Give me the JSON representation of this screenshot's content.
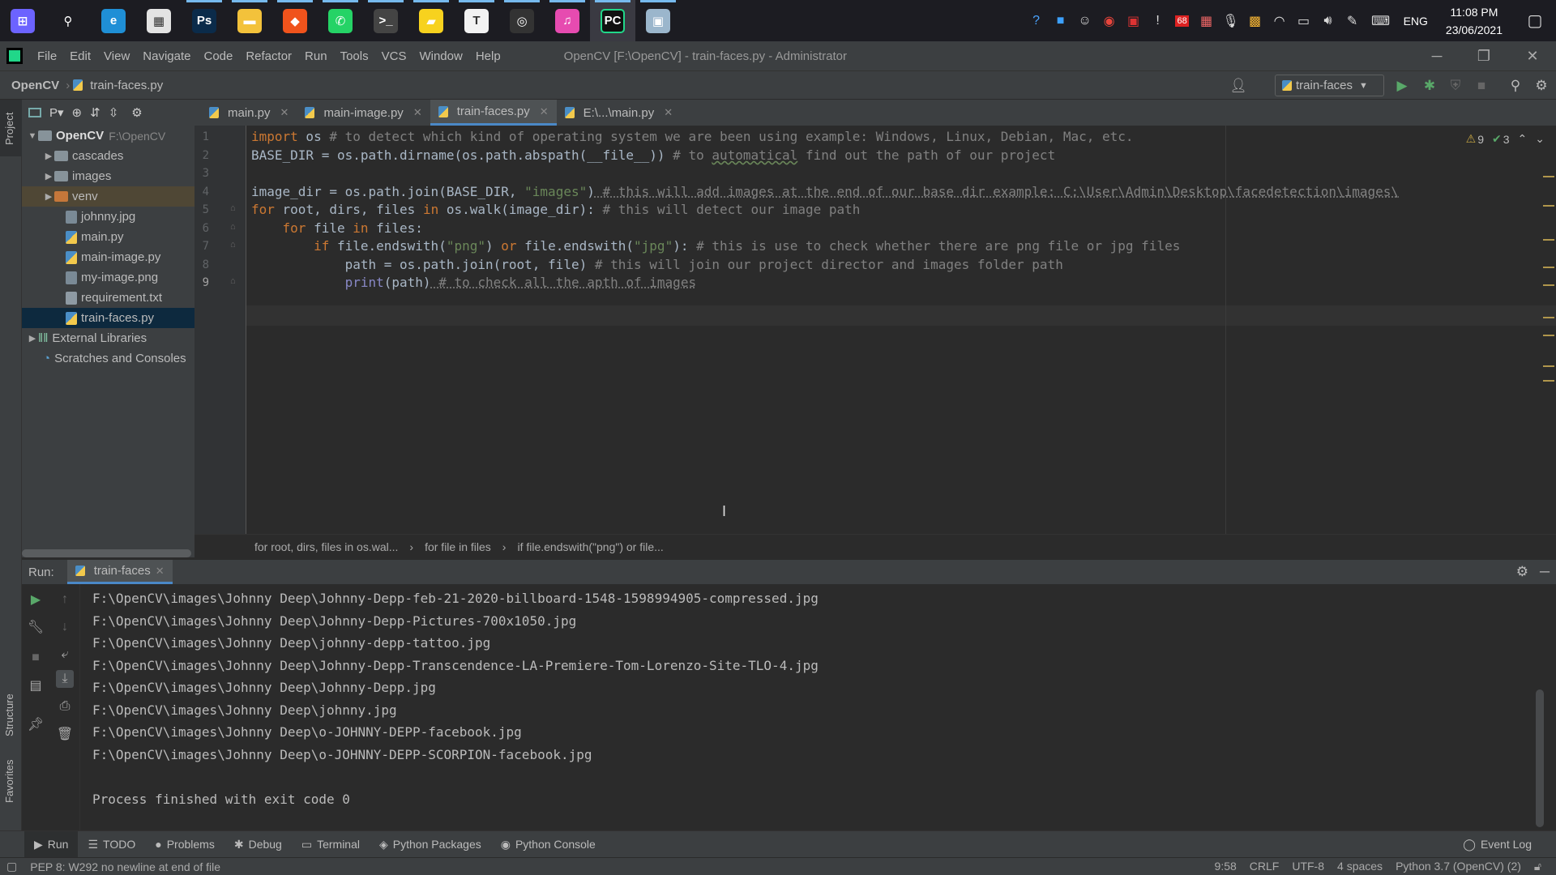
{
  "taskbar": {
    "apps": [
      {
        "name": "start-menu-icon",
        "glyph": "⊞",
        "color": "#6c63ff"
      },
      {
        "name": "search-icon",
        "glyph": "⚲",
        "color": "transparent"
      },
      {
        "name": "edge-icon",
        "glyph": "e",
        "color": "#1f8fd6"
      },
      {
        "name": "store-icon",
        "glyph": "▦",
        "color": "#e3e3e3"
      },
      {
        "name": "photoshop-icon",
        "glyph": "Ps",
        "color": "#0b2b4a"
      },
      {
        "name": "file-explorer-icon",
        "glyph": "▬",
        "color": "#f3c23b"
      },
      {
        "name": "brave-icon",
        "glyph": "◆",
        "color": "#f0531c"
      },
      {
        "name": "whatsapp-icon",
        "glyph": "✆",
        "color": "#25d366"
      },
      {
        "name": "terminal-icon",
        "glyph": ">_",
        "color": "#444"
      },
      {
        "name": "sticky-notes-icon",
        "glyph": "▰",
        "color": "#f7d21e"
      },
      {
        "name": "typora-icon",
        "glyph": "T",
        "color": "#f2f2f2"
      },
      {
        "name": "obs-icon",
        "glyph": "◎",
        "color": "#333"
      },
      {
        "name": "itunes-icon",
        "glyph": "♫",
        "color": "#e64bb0"
      },
      {
        "name": "pycharm-icon",
        "glyph": "PC",
        "color": "#111"
      },
      {
        "name": "remote-desktop-icon",
        "glyph": "▣",
        "color": "#9bb6cc"
      }
    ],
    "tray": {
      "language": "ENG",
      "time": "11:08 PM",
      "date": "23/06/2021",
      "badge_count": "68"
    }
  },
  "menubar": {
    "items": [
      "File",
      "Edit",
      "View",
      "Navigate",
      "Code",
      "Refactor",
      "Run",
      "Tools",
      "VCS",
      "Window",
      "Help"
    ],
    "window_title": "OpenCV [F:\\OpenCV] - train-faces.py - Administrator"
  },
  "navbar": {
    "project": "OpenCV",
    "file": "train-faces.py",
    "run_config": "train-faces"
  },
  "left_stripe": {
    "project_label": "Project",
    "structure_label": "Structure",
    "favorites_label": "Favorites"
  },
  "project_tree": {
    "toolbar_label": "P▾",
    "root": {
      "name": "OpenCV",
      "path": "F:\\OpenCV"
    },
    "items": [
      {
        "label": "cascades",
        "kind": "folder"
      },
      {
        "label": "images",
        "kind": "folder"
      },
      {
        "label": "venv",
        "kind": "venv"
      },
      {
        "label": "johnny.jpg",
        "kind": "img"
      },
      {
        "label": "main.py",
        "kind": "py"
      },
      {
        "label": "main-image.py",
        "kind": "py"
      },
      {
        "label": "my-image.png",
        "kind": "img"
      },
      {
        "label": "requirement.txt",
        "kind": "txt"
      },
      {
        "label": "train-faces.py",
        "kind": "py"
      }
    ],
    "external_libraries": "External Libraries",
    "scratches": "Scratches and Consoles"
  },
  "editor_tabs": [
    {
      "label": "main.py",
      "active": false
    },
    {
      "label": "main-image.py",
      "active": false
    },
    {
      "label": "train-faces.py",
      "active": true
    },
    {
      "label": "E:\\...\\main.py",
      "active": false
    }
  ],
  "editor": {
    "line_numbers": [
      "1",
      "2",
      "3",
      "4",
      "5",
      "6",
      "7",
      "8",
      "9"
    ],
    "warnings_count": "9",
    "weak_warnings_count": "3",
    "code": {
      "l1_kw": "import",
      "l1_code": " os",
      "l1_cmt": " # to detect which kind of operating system we are been using example: Windows, Linux, Debian, Mac, etc.",
      "l2_code": "BASE_DIR = os.path.dirname(os.path.abspath(__file__))",
      "l2_cmt_a": " # to ",
      "l2_cmt_typo": "automatical",
      "l2_cmt_b": " find out the path of our project",
      "l4_code_a": "image_dir = os.path.join(BASE_DIR, ",
      "l4_str": "\"images\"",
      "l4_code_b": ")",
      "l4_cmt": " # this will add images at the end of our base dir example: C:\\User\\Admin\\Desktop\\facedetection\\images\\",
      "l5_kw_a": "for",
      "l5_code_a": " root, dirs, files ",
      "l5_kw_b": "in",
      "l5_code_b": " os.walk(image_dir):",
      "l5_cmt": " # this will detect our image path",
      "l6_indent": "    ",
      "l6_kw_a": "for",
      "l6_code_a": " file ",
      "l6_kw_b": "in",
      "l6_code_b": " files:",
      "l7_indent": "        ",
      "l7_kw_a": "if",
      "l7_code_a": " file.endswith(",
      "l7_str_a": "\"png\"",
      "l7_code_b": ") ",
      "l7_kw_b": "or",
      "l7_code_c": " file.endswith(",
      "l7_str_b": "\"jpg\"",
      "l7_code_d": "):",
      "l7_cmt": " # this is use to check whether there are png file or jpg files",
      "l8_code": "            path = os.path.join(root, file)",
      "l8_cmt": " # this will join our project director and images folder path",
      "l9_indent": "            ",
      "l9_builtin": "print",
      "l9_code": "(path)",
      "l9_cmt": " # to check all the apth of images"
    },
    "breadcrumbs": [
      "for root, dirs, files in os.wal...",
      "for file in files",
      "if file.endswith(\"png\") or file..."
    ]
  },
  "run_panel": {
    "label": "Run:",
    "tab": "train-faces",
    "output": [
      "F:\\OpenCV\\images\\Johnny Deep\\Johnny-Depp-feb-21-2020-billboard-1548-1598994905-compressed.jpg",
      "F:\\OpenCV\\images\\Johnny Deep\\Johnny-Depp-Pictures-700x1050.jpg",
      "F:\\OpenCV\\images\\Johnny Deep\\johnny-depp-tattoo.jpg",
      "F:\\OpenCV\\images\\Johnny Deep\\Johnny-Depp-Transcendence-LA-Premiere-Tom-Lorenzo-Site-TLO-4.jpg",
      "F:\\OpenCV\\images\\Johnny Deep\\Johnny-Depp.jpg",
      "F:\\OpenCV\\images\\Johnny Deep\\johnny.jpg",
      "F:\\OpenCV\\images\\Johnny Deep\\o-JOHNNY-DEPP-facebook.jpg",
      "F:\\OpenCV\\images\\Johnny Deep\\o-JOHNNY-DEPP-SCORPION-facebook.jpg",
      "",
      "Process finished with exit code 0"
    ]
  },
  "bottom_tools": [
    {
      "label": "Run",
      "icon": "▶",
      "name": "run-tool-button",
      "active": true
    },
    {
      "label": "TODO",
      "icon": "☰",
      "name": "todo-tool-button",
      "active": false
    },
    {
      "label": "Problems",
      "icon": "●",
      "name": "problems-tool-button",
      "active": false
    },
    {
      "label": "Debug",
      "icon": "✱",
      "name": "debug-tool-button",
      "active": false
    },
    {
      "label": "Terminal",
      "icon": "▭",
      "name": "terminal-tool-button",
      "active": false
    },
    {
      "label": "Python Packages",
      "icon": "◈",
      "name": "python-packages-tool-button",
      "active": false
    },
    {
      "label": "Python Console",
      "icon": "◉",
      "name": "python-console-tool-button",
      "active": false
    }
  ],
  "event_log": "Event Log",
  "statusbar": {
    "message": "PEP 8: W292 no newline at end of file",
    "position": "9:58",
    "line_sep": "CRLF",
    "encoding": "UTF-8",
    "indent": "4 spaces",
    "interpreter": "Python 3.7 (OpenCV) (2)"
  },
  "colors": {
    "accent": "#4a88c7",
    "keyword": "#cc7832",
    "string": "#6a8759",
    "comment": "#808080",
    "run_green": "#59a869"
  }
}
